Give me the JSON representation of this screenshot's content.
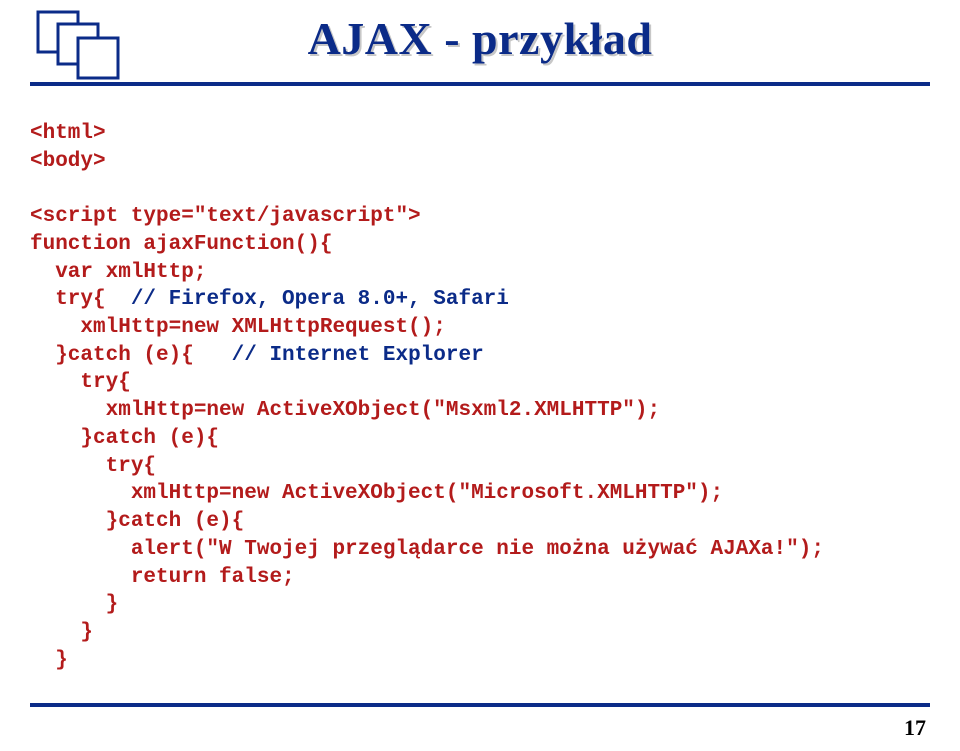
{
  "title": "AJAX - przykład",
  "page_number": "17",
  "code_lines": [
    {
      "segments": [
        {
          "t": "<html>",
          "c": "red"
        }
      ]
    },
    {
      "segments": [
        {
          "t": "<body>",
          "c": "red"
        }
      ]
    },
    {
      "segments": [
        {
          "t": "",
          "c": "red"
        }
      ]
    },
    {
      "segments": [
        {
          "t": "<script type=\"text/javascript\">",
          "c": "red"
        }
      ]
    },
    {
      "segments": [
        {
          "t": "function ajaxFunction(){",
          "c": "red"
        }
      ]
    },
    {
      "segments": [
        {
          "t": "  var xmlHttp;",
          "c": "red"
        }
      ]
    },
    {
      "segments": [
        {
          "t": "  try{  ",
          "c": "red"
        },
        {
          "t": "// Firefox, Opera 8.0+, Safari",
          "c": "blue"
        }
      ]
    },
    {
      "segments": [
        {
          "t": "    xmlHttp=new XMLHttpRequest();",
          "c": "red"
        }
      ]
    },
    {
      "segments": [
        {
          "t": "  }catch (e){   ",
          "c": "red"
        },
        {
          "t": "// Internet Explorer",
          "c": "blue"
        }
      ]
    },
    {
      "segments": [
        {
          "t": "    try{",
          "c": "red"
        }
      ]
    },
    {
      "segments": [
        {
          "t": "      xmlHttp=new ActiveXObject(\"Msxml2.XMLHTTP\");",
          "c": "red"
        }
      ]
    },
    {
      "segments": [
        {
          "t": "    }catch (e){",
          "c": "red"
        }
      ]
    },
    {
      "segments": [
        {
          "t": "      try{",
          "c": "red"
        }
      ]
    },
    {
      "segments": [
        {
          "t": "        xmlHttp=new ActiveXObject(\"Microsoft.XMLHTTP\");",
          "c": "red"
        }
      ]
    },
    {
      "segments": [
        {
          "t": "      }catch (e){",
          "c": "red"
        }
      ]
    },
    {
      "segments": [
        {
          "t": "        alert(\"W Twojej przeglądarce nie można używać AJAXa!\");",
          "c": "red"
        }
      ]
    },
    {
      "segments": [
        {
          "t": "        return false;",
          "c": "red"
        }
      ]
    },
    {
      "segments": [
        {
          "t": "      }",
          "c": "red"
        }
      ]
    },
    {
      "segments": [
        {
          "t": "    }",
          "c": "red"
        }
      ]
    },
    {
      "segments": [
        {
          "t": "  }",
          "c": "red"
        }
      ]
    }
  ]
}
